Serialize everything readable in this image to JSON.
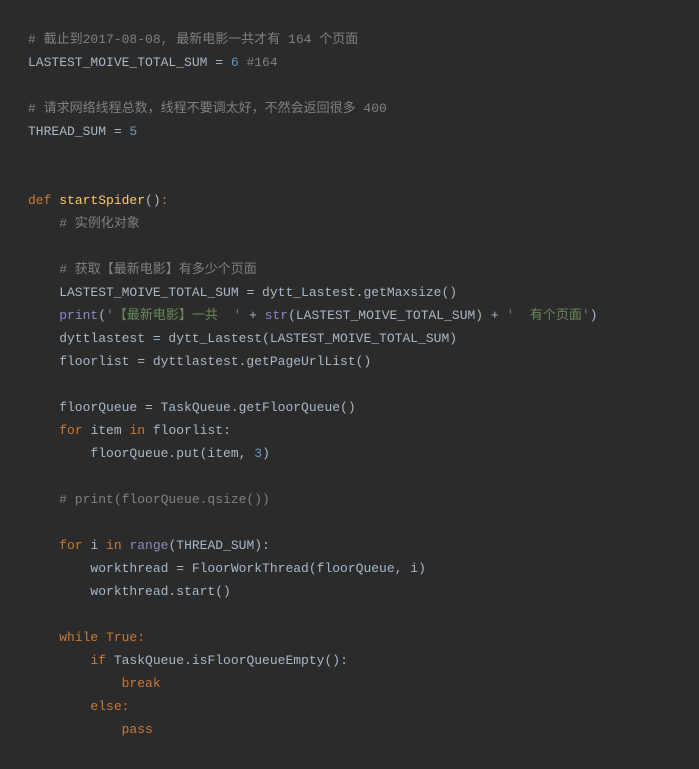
{
  "code": {
    "l1_comment": "# 截止到2017-08-08, 最新电影一共才有 164 个页面",
    "l2_var": "LASTEST_MOIVE_TOTAL_SUM",
    "l2_eq": " = ",
    "l2_num": "6",
    "l2_c": " #164",
    "l4_comment": "# 请求网络线程总数，线程不要调太好，不然会返回很多 400",
    "l5_var": "THREAD_SUM",
    "l5_eq": " = ",
    "l5_num": "5",
    "l8_def": "def ",
    "l8_fn": "startSpider",
    "l8_paren": "()",
    "l8_colon": ":",
    "l9_c": "    # 实例化对象",
    "l11_c": "    # 获取【最新电影】有多少个页面",
    "l12_a": "    LASTEST_MOIVE_TOTAL_SUM ",
    "l12_eq": "=",
    "l12_b": " dytt_Lastest.getMaxsize()",
    "l13_a": "    ",
    "l13_print": "print",
    "l13_op": "(",
    "l13_s1": "'【最新电影】一共  '",
    "l13_plus1": " + ",
    "l13_str": "str",
    "l13_strp": "(LASTEST_MOIVE_TOTAL_SUM)",
    "l13_plus2": " + ",
    "l13_s2": "'  有个页面'",
    "l13_cp": ")",
    "l14": "    dyttlastest = dytt_Lastest(LASTEST_MOIVE_TOTAL_SUM)",
    "l15": "    floorlist = dyttlastest.getPageUrlList()",
    "l17": "    floorQueue = TaskQueue.getFloorQueue()",
    "l18_ind": "    ",
    "l18_for": "for ",
    "l18_item": "item ",
    "l18_in": "in ",
    "l18_rest": "floorlist:",
    "l19_a": "        floorQueue.put(item",
    "l19_comma": ", ",
    "l19_num": "3",
    "l19_cp": ")",
    "l21_c": "    # print(floorQueue.qsize())",
    "l23_ind": "    ",
    "l23_for": "for ",
    "l23_i": "i ",
    "l23_in": "in ",
    "l23_range": "range",
    "l23_rp": "(THREAD_SUM):",
    "l24": "        workthread = FloorWorkThread(floorQueue",
    "l24_comma": ", ",
    "l24_i": "i)",
    "l25": "        workthread.start()",
    "l27_ind": "    ",
    "l27_while": "while ",
    "l27_true": "True",
    "l27_colon": ":",
    "l28_ind": "        ",
    "l28_if": "if ",
    "l28_cond": "TaskQueue.isFloorQueueEmpty():",
    "l29_ind": "            ",
    "l29_break": "break",
    "l30_ind": "        ",
    "l30_else": "else",
    "l30_colon": ":",
    "l31_ind": "            ",
    "l31_pass": "pass"
  }
}
